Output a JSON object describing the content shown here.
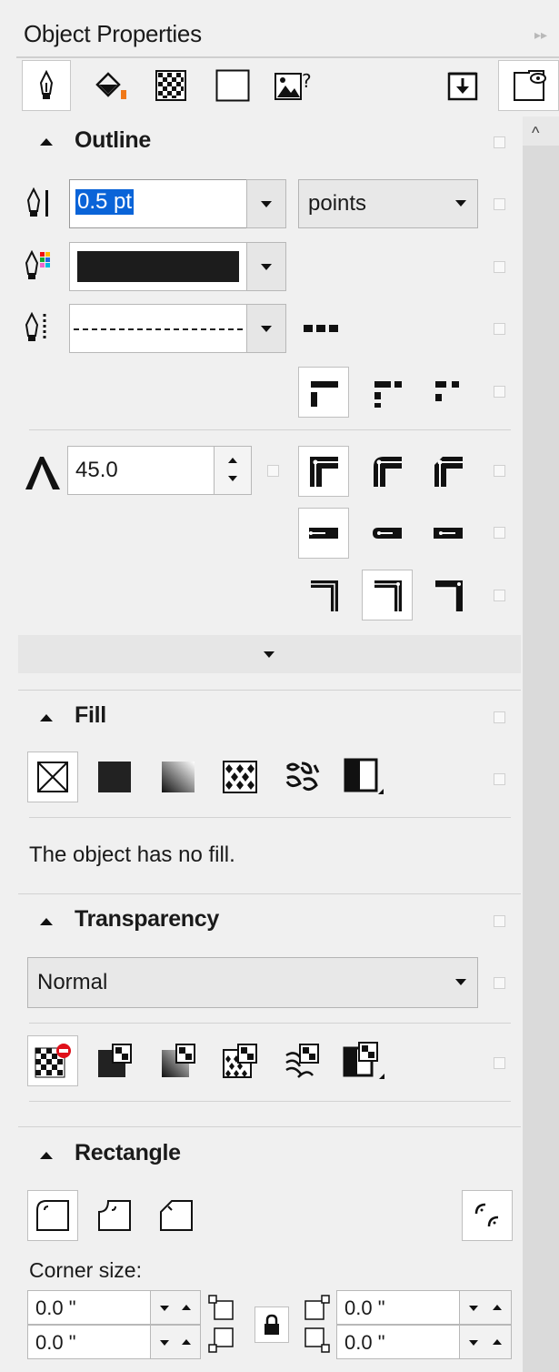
{
  "panel": {
    "title": "Object Properties"
  },
  "tabs": [
    {
      "name": "outline-tab",
      "icon": "pen-nib-icon",
      "active": true
    },
    {
      "name": "fill-tab",
      "icon": "fill-bucket-icon"
    },
    {
      "name": "transparency-tab",
      "icon": "checker-icon"
    },
    {
      "name": "rectangle-tab",
      "icon": "rectangle-icon"
    },
    {
      "name": "bitmap-tab",
      "icon": "image-question-icon"
    },
    {
      "name": "export-tab",
      "icon": "download-icon"
    },
    {
      "name": "view-tab",
      "icon": "page-eye-icon"
    }
  ],
  "outline": {
    "header": "Outline",
    "width_value": "0.5 pt",
    "units_value": "points",
    "color": "#1c1c1c",
    "miter_value": "45.0"
  },
  "fill": {
    "header": "Fill",
    "message": "The object has no fill."
  },
  "transparency": {
    "header": "Transparency",
    "mode_value": "Normal"
  },
  "rectangle": {
    "header": "Rectangle",
    "corner_size_label": "Corner size:",
    "corner_tl": "0.0 \"",
    "corner_bl": "0.0 \"",
    "corner_tr": "0.0 \"",
    "corner_br": "0.0 \""
  }
}
